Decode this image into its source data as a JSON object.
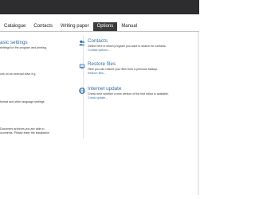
{
  "tabs": [
    {
      "label": "Catalogue"
    },
    {
      "label": "Contacts"
    },
    {
      "label": "Writing paper"
    },
    {
      "label": "Options",
      "active": true
    },
    {
      "label": "Manual"
    }
  ],
  "left_column": {
    "basic_settings": {
      "title": "asic settings",
      "desc": "settings for the program and printing."
    },
    "external_drive": {
      "desc": "ook on an external drive e.g."
    },
    "language": {
      "desc": "format and other language settings"
    },
    "archive": {
      "line1": "Document archives you are able to",
      "line2": "ocuments. Please enter the installation"
    }
  },
  "right_column": {
    "contacts": {
      "title": "Contacts",
      "desc": "Define here in which program you want to search for contacts.",
      "link": "Contact options..."
    },
    "restore": {
      "title": "Restore files",
      "desc": "Here you can restore your files from a previous backup.",
      "link": "Restore files..."
    },
    "update": {
      "title": "Internet update",
      "desc": "Check here whether a new version of the text editor is available.",
      "link": "Check update..."
    }
  },
  "colors": {
    "titlebar": "#2d2d30",
    "accent": "#2f6ea6",
    "active_tab": "#3b3b3b"
  },
  "icons": [
    "contacts-icon",
    "restore-icon",
    "internet-update-icon"
  ]
}
